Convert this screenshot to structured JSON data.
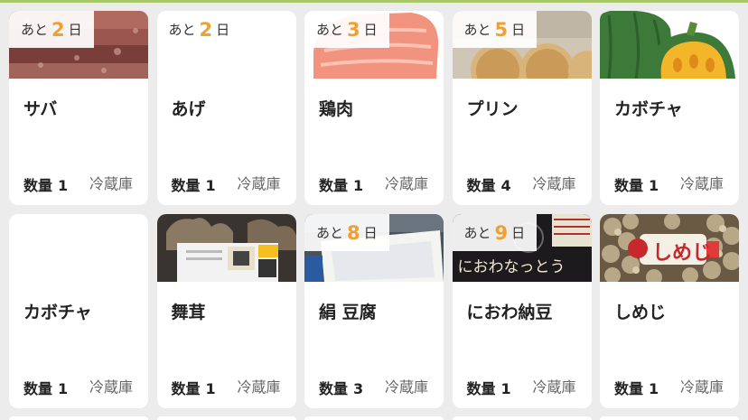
{
  "badge": {
    "prefix": "あと",
    "suffix": "日"
  },
  "labels": {
    "quantity": "数量"
  },
  "colors": {
    "accent": "#f0a033",
    "topbar": "#a8c86a"
  },
  "items": [
    {
      "name": "サバ",
      "days": "2",
      "quantity": "1",
      "location": "冷蔵庫",
      "image": "fish-photo"
    },
    {
      "name": "あげ",
      "days": "2",
      "quantity": "1",
      "location": "冷蔵庫",
      "image": "none"
    },
    {
      "name": "鶏肉",
      "days": "3",
      "quantity": "1",
      "location": "冷蔵庫",
      "image": "chicken-illustration"
    },
    {
      "name": "プリン",
      "days": "5",
      "quantity": "4",
      "location": "冷蔵庫",
      "image": "pudding-photo"
    },
    {
      "name": "カボチャ",
      "days": "",
      "quantity": "1",
      "location": "冷蔵庫",
      "image": "pumpkin-illustration"
    },
    {
      "name": "カボチャ",
      "days": "",
      "quantity": "1",
      "location": "冷蔵庫",
      "image": "none"
    },
    {
      "name": "舞茸",
      "days": "",
      "quantity": "1",
      "location": "冷蔵庫",
      "image": "maitake-photo"
    },
    {
      "name": "絹 豆腐",
      "days": "8",
      "quantity": "3",
      "location": "冷蔵庫",
      "image": "tofu-photo"
    },
    {
      "name": "におわ納豆",
      "days": "9",
      "quantity": "1",
      "location": "冷蔵庫",
      "image": "natto-photo",
      "image_text": "におわなっとう"
    },
    {
      "name": "しめじ",
      "days": "",
      "quantity": "1",
      "location": "冷蔵庫",
      "image": "shimeji-photo",
      "image_text": "しめじ"
    }
  ]
}
